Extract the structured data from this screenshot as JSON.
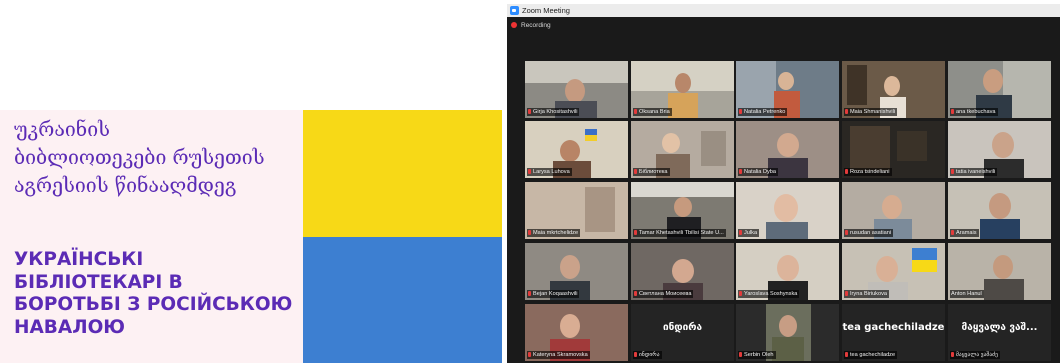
{
  "banner": {
    "georgian_lines": [
      "უკრაინის",
      "ბიბლიოთეკები რუსეთის",
      "აგრესიის წინააღმდეგ"
    ],
    "ukrainian_lines": [
      "УКРАЇНСЬКІ",
      "БІБЛІОТЕКАРІ В",
      "БОРОТЬБІ З РОСІЙСЬКОЮ",
      "НАВАЛОЮ"
    ],
    "colors": {
      "purple": "#5b2bb5",
      "flag_yellow": "#f7d917",
      "flag_blue": "#3d7fd1",
      "background": "#fdf1f3"
    }
  },
  "zoom": {
    "window_title": "Zoom Meeting",
    "recording_label": "Recording",
    "accent_active": "#8ad94b",
    "participants": [
      {
        "name": "Girja Khositashvili",
        "big_label": ""
      },
      {
        "name": "Oksana Bria",
        "big_label": ""
      },
      {
        "name": "Natalia Petrenko",
        "big_label": ""
      },
      {
        "name": "Maia Shmanishvili",
        "big_label": ""
      },
      {
        "name": "ana tkebuchava",
        "big_label": ""
      },
      {
        "name": "Larysa Luhova",
        "big_label": ""
      },
      {
        "name": "Біблиотека",
        "big_label": ""
      },
      {
        "name": "Natalia Dyba",
        "big_label": ""
      },
      {
        "name": "Roza tsindeliani",
        "big_label": ""
      },
      {
        "name": "tatia ivaneishvili",
        "big_label": ""
      },
      {
        "name": "Maia mkrtchelidze",
        "big_label": ""
      },
      {
        "name": "Tamar Khetashvili Tbilisi State U...",
        "big_label": ""
      },
      {
        "name": "Julka",
        "big_label": ""
      },
      {
        "name": "rusudan asatiani",
        "big_label": ""
      },
      {
        "name": "Aramais",
        "big_label": ""
      },
      {
        "name": "Bejan Koqaashvili",
        "big_label": ""
      },
      {
        "name": "Светлана Моисеева",
        "big_label": ""
      },
      {
        "name": "Yaroslava Soshynska",
        "big_label": ""
      },
      {
        "name": "Iryna Biriukova",
        "big_label": ""
      },
      {
        "name": "Anton Hanul",
        "big_label": ""
      },
      {
        "name": "Kateryna Skramovska",
        "big_label": ""
      },
      {
        "name": "ინდირა",
        "big_label": "ინდირა"
      },
      {
        "name": "Serbin Oleh",
        "big_label": ""
      },
      {
        "name": "tea gachechiladze",
        "big_label": "tea gachechiladze"
      },
      {
        "name": "მაყვალა ვაშაძე",
        "big_label": "მაყვალა ვაშ..."
      }
    ]
  }
}
